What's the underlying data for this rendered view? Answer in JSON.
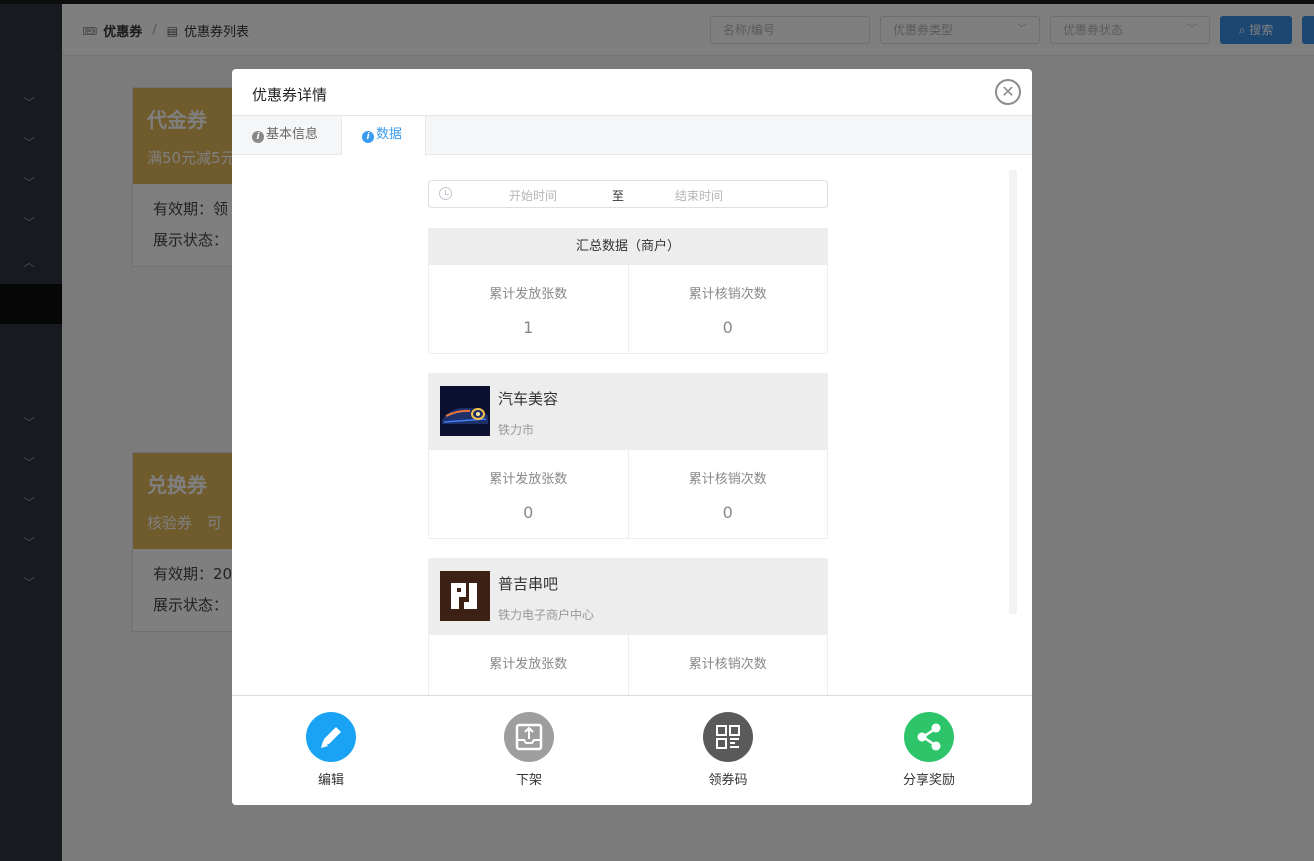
{
  "breadcrumb": {
    "root": "优惠券",
    "current": "优惠券列表"
  },
  "header": {
    "name_placeholder": "名称/编号",
    "type_placeholder": "优惠券类型",
    "status_placeholder": "优惠券状态",
    "search_label": "搜索"
  },
  "background_coupons": [
    {
      "title": "代金券",
      "subtitle": "满50元减5元",
      "validity_label": "有效期：领",
      "display_label": "展示状态："
    },
    {
      "title": "兑换券",
      "subtitle": "核验券　可",
      "validity_label": "有效期：20",
      "display_label": "展示状态："
    }
  ],
  "modal": {
    "title": "优惠券详情",
    "close_symbol": "✕",
    "tabs": [
      {
        "label": "基本信息",
        "active": false
      },
      {
        "label": "数据",
        "active": true
      }
    ],
    "date_range": {
      "start_placeholder": "开始时间",
      "separator": "至",
      "end_placeholder": "结束时间"
    },
    "summary": {
      "title": "汇总数据（商户）",
      "issued_label": "累计发放张数",
      "issued_value": "1",
      "redeemed_label": "累计核销次数",
      "redeemed_value": "0"
    },
    "shops": [
      {
        "name": "汽车美容",
        "location": "铁力市",
        "issued_label": "累计发放张数",
        "issued_value": "0",
        "redeemed_label": "累计核销次数",
        "redeemed_value": "0"
      },
      {
        "name": "普吉串吧",
        "location": "铁力电子商户中心",
        "issued_label": "累计发放张数",
        "redeemed_label": "累计核销次数"
      }
    ],
    "actions": [
      {
        "label": "编辑",
        "icon": "pencil-icon",
        "color": "#1aa3f5"
      },
      {
        "label": "下架",
        "icon": "unshelve-icon",
        "color": "#9e9e9e"
      },
      {
        "label": "领券码",
        "icon": "qrcode-icon",
        "color": "#5a5a5a"
      },
      {
        "label": "分享奖励",
        "icon": "share-icon",
        "color": "#2ec56a"
      }
    ]
  },
  "colors": {
    "accent": "#3a9cf0",
    "coupon_gold": "#e0b75a",
    "sidebar": "#2f3640"
  }
}
